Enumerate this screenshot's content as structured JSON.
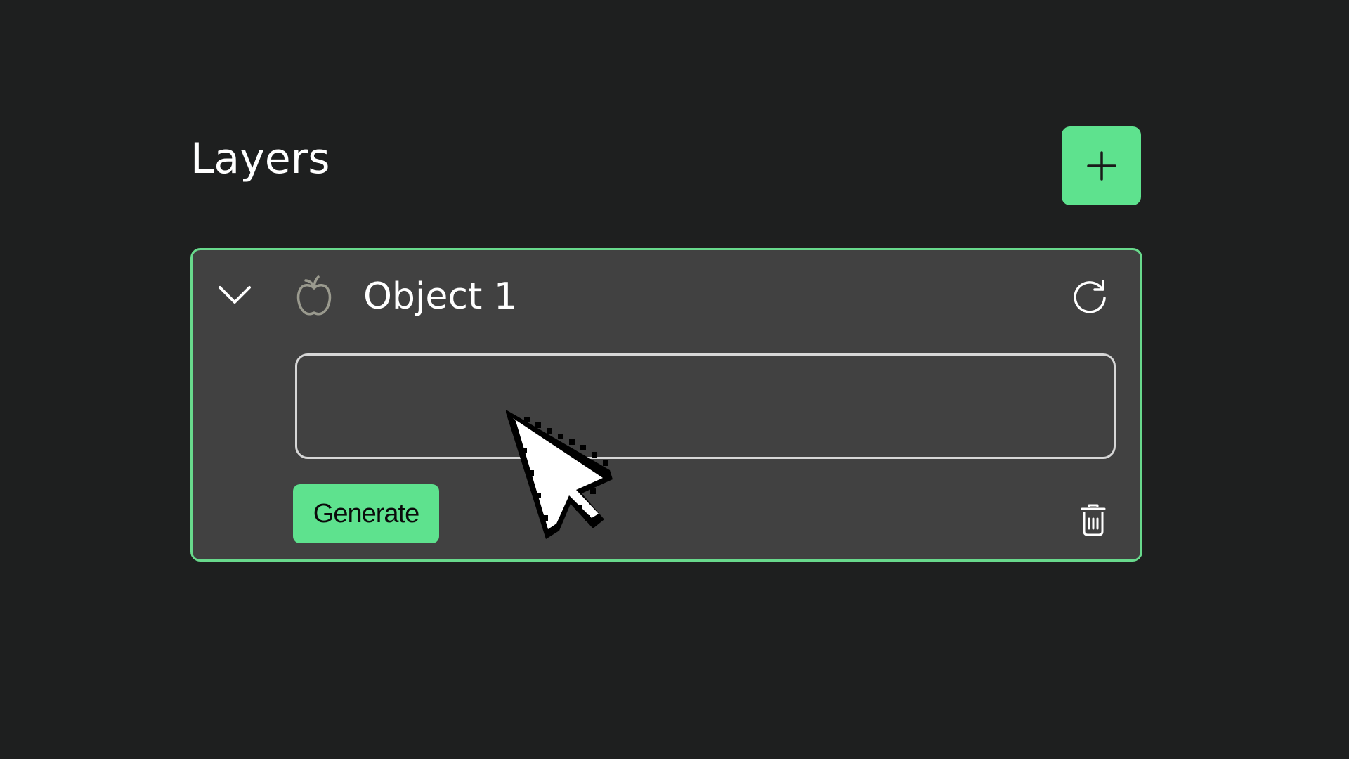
{
  "panel": {
    "title": "Layers",
    "add_button_icon": "plus-icon"
  },
  "layer": {
    "name": "Object 1",
    "icon": "apple-icon",
    "expand_icon": "chevron-down-icon",
    "refresh_icon": "refresh-icon",
    "prompt_value": "",
    "prompt_placeholder": "",
    "generate_label": "Generate",
    "delete_icon": "trash-icon"
  },
  "cursor": {
    "icon": "pointer-cursor-icon"
  },
  "colors": {
    "background": "#1e1f1f",
    "card": "#414141",
    "accent": "#5ee28e",
    "card_border": "#68d98c",
    "input_border": "#d6d6d6",
    "text": "#ffffff",
    "icon_muted": "#9a9a8e"
  }
}
